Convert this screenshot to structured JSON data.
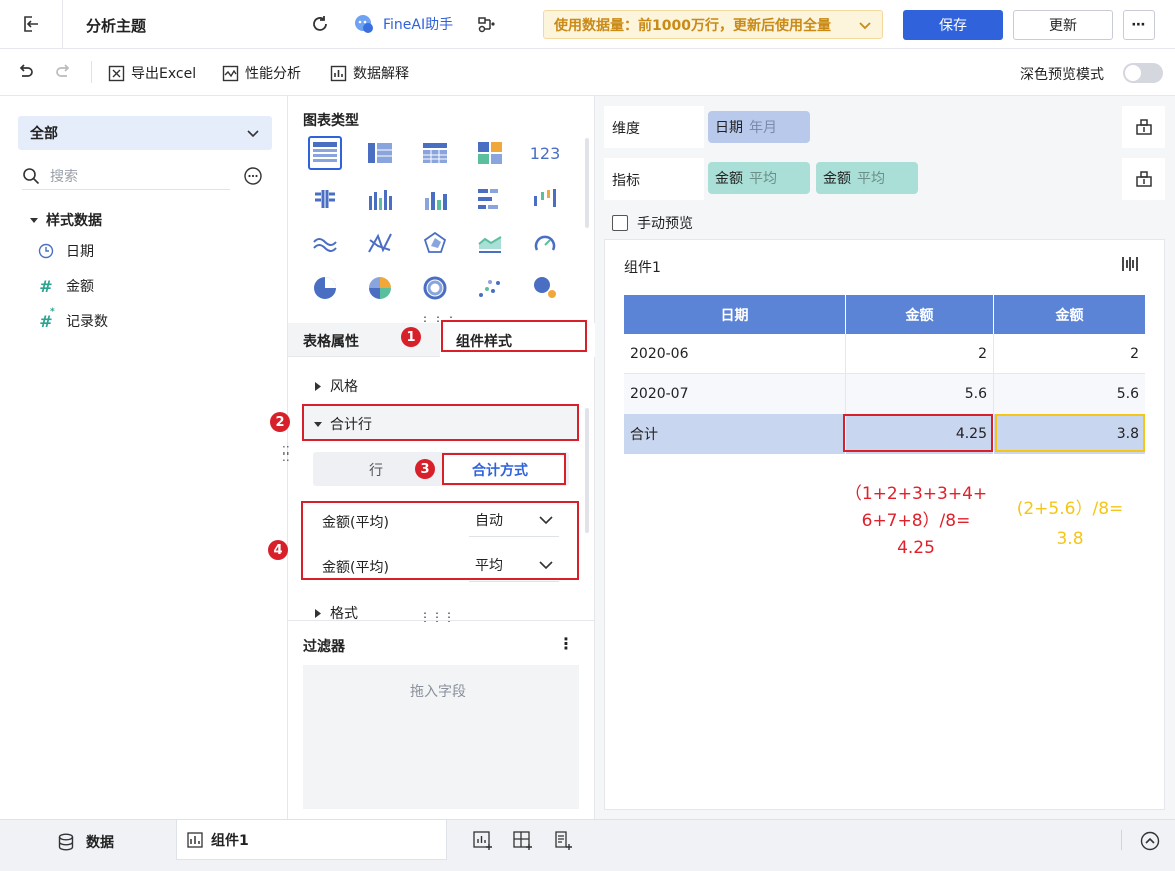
{
  "header": {
    "title": "分析主题",
    "ai_label": "FineAI助手",
    "notice": "使用数据量：前1000万行，更新后使用全量",
    "save_label": "保存",
    "update_label": "更新"
  },
  "toolbar": {
    "export_label": "导出Excel",
    "perf_label": "性能分析",
    "explain_label": "数据解释",
    "dark_mode_label": "深色预览模式"
  },
  "left": {
    "dataset_select": "全部",
    "search_placeholder": "搜索",
    "table_name": "样式数据",
    "fields": [
      {
        "name": "日期",
        "icon": "clock-icon"
      },
      {
        "name": "金额",
        "icon": "hash-icon"
      },
      {
        "name": "记录数",
        "icon": "hash-star-icon"
      }
    ]
  },
  "middle": {
    "chart_type_title": "图表类型",
    "tab_table_props": "表格属性",
    "tab_component_style": "组件样式",
    "section_style": "风格",
    "section_total_row": "合计行",
    "subtab_row": "行",
    "subtab_total_method": "合计方式",
    "total_rows": [
      {
        "label": "金额(平均)",
        "value": "自动"
      },
      {
        "label": "金额(平均)",
        "value": "平均"
      }
    ],
    "section_format": "格式",
    "filter_title": "过滤器",
    "filter_drop_hint": "拖入字段"
  },
  "right": {
    "dimension_label": "维度",
    "dimension_pill": {
      "name": "日期",
      "sub": "年月"
    },
    "metric_label": "指标",
    "metric_pills": [
      {
        "name": "金额",
        "sub": "平均"
      },
      {
        "name": "金额",
        "sub": "平均"
      }
    ],
    "manual_preview_label": "手动预览",
    "component_title": "组件1",
    "table": {
      "headers": [
        "日期",
        "金额",
        "金额"
      ],
      "rows": [
        [
          "2020-06",
          "2",
          "2"
        ],
        [
          "2020-07",
          "5.6",
          "5.6"
        ]
      ],
      "total_row": [
        "合计",
        "4.25",
        "3.8"
      ]
    },
    "annotation_red": [
      "（1+2+3+3+4+",
      "6+7+8）/8=",
      "4.25"
    ],
    "annotation_yellow": [
      "(2+5.6）/8=",
      "3.8"
    ]
  },
  "annotations": {
    "badges": [
      "1",
      "2",
      "3",
      "4"
    ]
  },
  "bottom": {
    "data_tab": "数据",
    "component_tab": "组件1"
  },
  "colors": {
    "primary": "#2f62db",
    "table_header": "#5b83d6",
    "total_row": "#c9d6ef",
    "dimension_pill": "#b8c9ec",
    "metric_pill": "#a9dfd6",
    "annotation_red": "#e0202a",
    "annotation_yellow": "#f5c518",
    "notice_bg": "#fdf4dc"
  }
}
